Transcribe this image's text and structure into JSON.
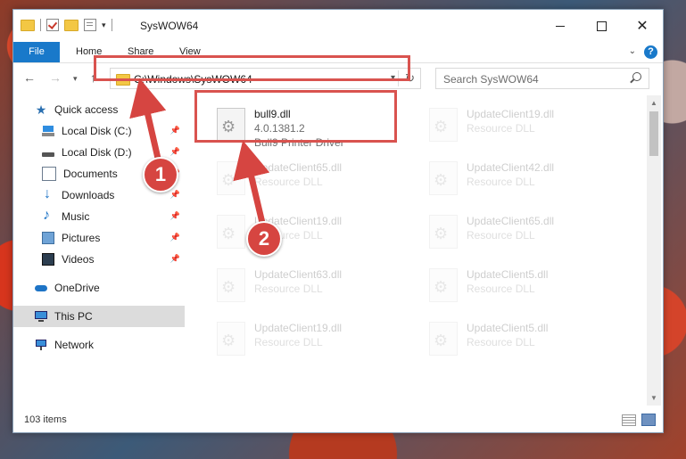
{
  "window": {
    "title": "SysWOW64",
    "controls": {
      "minimize": "minimize-icon",
      "maximize": "maximize-icon",
      "close": "✕"
    }
  },
  "ribbon": {
    "tabs": [
      "File",
      "Home",
      "Share",
      "View"
    ],
    "help": "?"
  },
  "navigation": {
    "address": "C:\\Windows\\SysWOW64",
    "search_placeholder": "Search SysWOW64"
  },
  "sidebar": {
    "items": [
      {
        "label": "Quick access",
        "icon": "star-icon"
      },
      {
        "label": "Local Disk (C:)",
        "icon": "drive-icon",
        "pinned": true
      },
      {
        "label": "Local Disk (D:)",
        "icon": "drive-icon",
        "pinned": true
      },
      {
        "label": "Documents",
        "icon": "documents-icon",
        "pinned": true
      },
      {
        "label": "Downloads",
        "icon": "downloads-icon",
        "pinned": true
      },
      {
        "label": "Music",
        "icon": "music-icon",
        "pinned": true
      },
      {
        "label": "Pictures",
        "icon": "pictures-icon",
        "pinned": true
      },
      {
        "label": "Videos",
        "icon": "videos-icon",
        "pinned": true
      },
      {
        "label": "OneDrive",
        "icon": "onedrive-icon"
      },
      {
        "label": "This PC",
        "icon": "this-pc-icon",
        "selected": true
      },
      {
        "label": "Network",
        "icon": "network-icon"
      }
    ]
  },
  "files": [
    {
      "name": "bull9.dll",
      "line2": "4.0.1381.2",
      "line3": "Bull9 Printer Driver",
      "highlighted": true
    },
    {
      "name": "UpdateClient19.dll",
      "line2": "Resource DLL"
    },
    {
      "name": "UpdateClient65.dll",
      "line2": "Resource DLL"
    },
    {
      "name": "UpdateClient42.dll",
      "line2": "Resource DLL"
    },
    {
      "name": "UpdateClient19.dll",
      "line2": "Resource DLL"
    },
    {
      "name": "UpdateClient65.dll",
      "line2": "Resource DLL"
    },
    {
      "name": "UpdateClient63.dll",
      "line2": "Resource DLL"
    },
    {
      "name": "UpdateClient5.dll",
      "line2": "Resource DLL"
    },
    {
      "name": "UpdateClient19.dll",
      "line2": "Resource DLL"
    },
    {
      "name": "UpdateClient5.dll",
      "line2": "Resource DLL"
    }
  ],
  "status": {
    "count": "103 items"
  },
  "annotations": {
    "step1": "1",
    "step2": "2"
  },
  "colors": {
    "accent": "#1979ca",
    "highlight": "#d9534f"
  }
}
